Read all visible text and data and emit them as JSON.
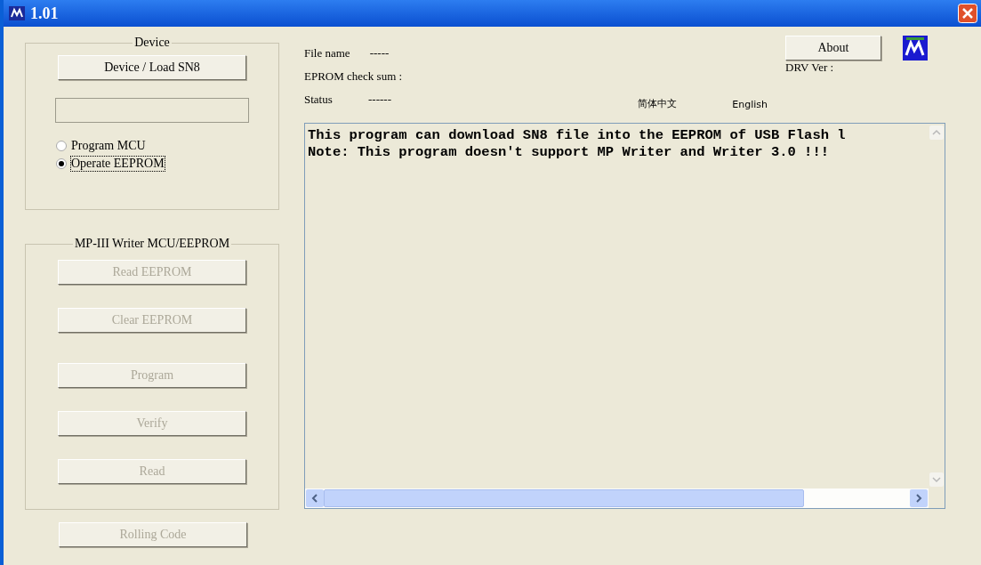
{
  "window": {
    "title": "1.01"
  },
  "device_group": {
    "title": "Device",
    "load_button": "Device / Load SN8",
    "modes": [
      {
        "label": "Program MCU",
        "selected": false
      },
      {
        "label": "Operate EEPROM",
        "selected": true
      }
    ]
  },
  "writer_group": {
    "title": "MP-III Writer MCU/EEPROM",
    "buttons": [
      {
        "label": "Read EEPROM",
        "disabled": true
      },
      {
        "label": "Clear EEPROM",
        "disabled": true
      },
      {
        "label": "Program",
        "disabled": true
      },
      {
        "label": "Verify",
        "disabled": true
      },
      {
        "label": "Read",
        "disabled": true
      }
    ]
  },
  "rolling_code_button": {
    "label": "Rolling Code",
    "disabled": true
  },
  "info": {
    "file_name_label": "File name",
    "file_name_value": "-----",
    "checksum_label": "EPROM check sum :",
    "status_label": "Status",
    "status_value": "------"
  },
  "about_button": "About",
  "drv_ver_label": "DRV Ver :",
  "languages": [
    {
      "label": "简体中文"
    },
    {
      "label": "English"
    }
  ],
  "log_lines": [
    "This program can download SN8 file into the EEPROM of USB Flash l",
    "Note: This program doesn't support MP Writer and Writer 3.0 !!!"
  ]
}
